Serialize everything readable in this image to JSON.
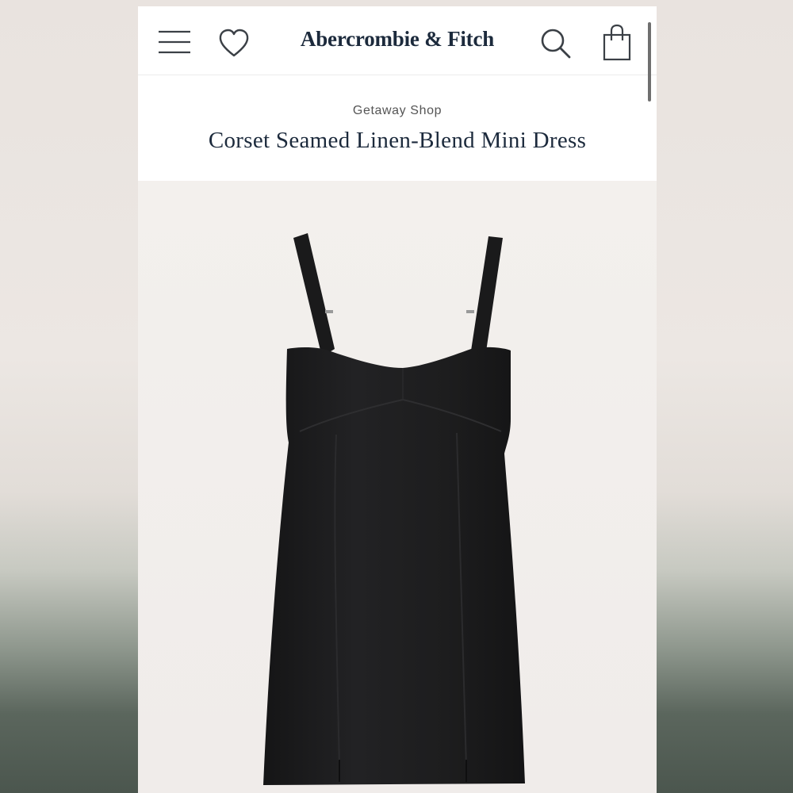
{
  "header": {
    "brand": "Abercrombie & Fitch",
    "icons": {
      "menu": "hamburger-menu-icon",
      "wishlist": "heart-icon",
      "search": "search-icon",
      "bag": "shopping-bag-icon"
    }
  },
  "product": {
    "collection": "Getaway Shop",
    "title": "Corset Seamed Linen-Blend Mini Dress",
    "color": "#1e1e1f"
  },
  "colors": {
    "brand_text": "#1c2a3c",
    "background": "#ffffff",
    "photo_bg": "#f2efec"
  }
}
